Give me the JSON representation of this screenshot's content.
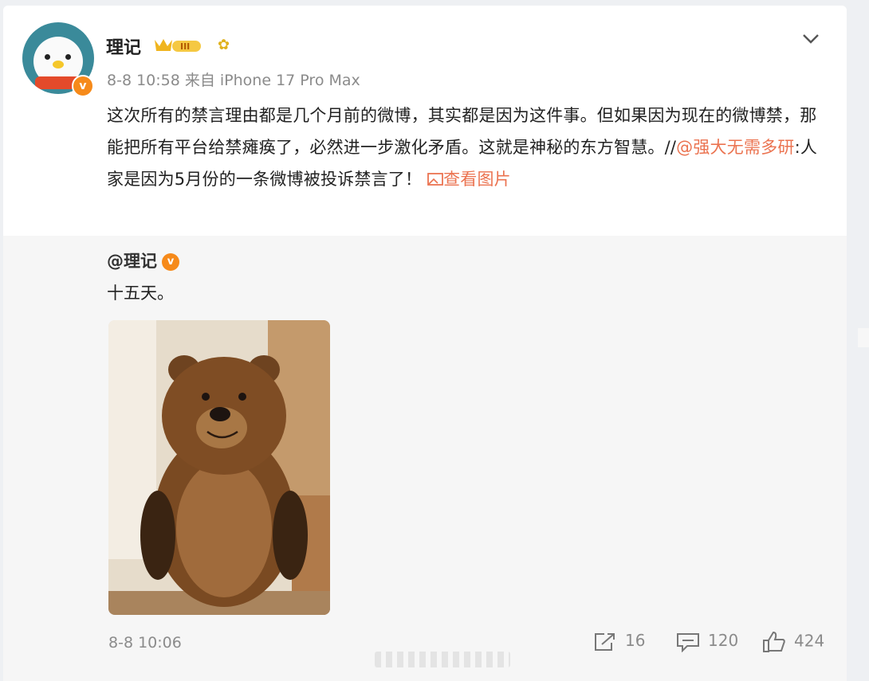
{
  "post": {
    "username": "理记",
    "meta": "8-8 10:58 来自 iPhone 17 Pro Max",
    "text_main": "这次所有的禁言理由都是几个月前的微博，其实都是因为这件事。但如果因为现在的微博禁，那能把所有平台给禁瘫痪了，必然进一步激化矛盾。这就是神秘的东方智慧。//",
    "mention": "@强大无需多研",
    "text_tail": ":人家是因为5月份的一条微博被投诉禁言了！",
    "view_image": "查看图片"
  },
  "repost": {
    "user": "@理记",
    "text": "十五天。",
    "time": "8-8 10:06",
    "reposts": "16",
    "comments": "120",
    "likes": "424"
  },
  "colors": {
    "link": "#eb7350",
    "verified": "#f68a1a"
  }
}
